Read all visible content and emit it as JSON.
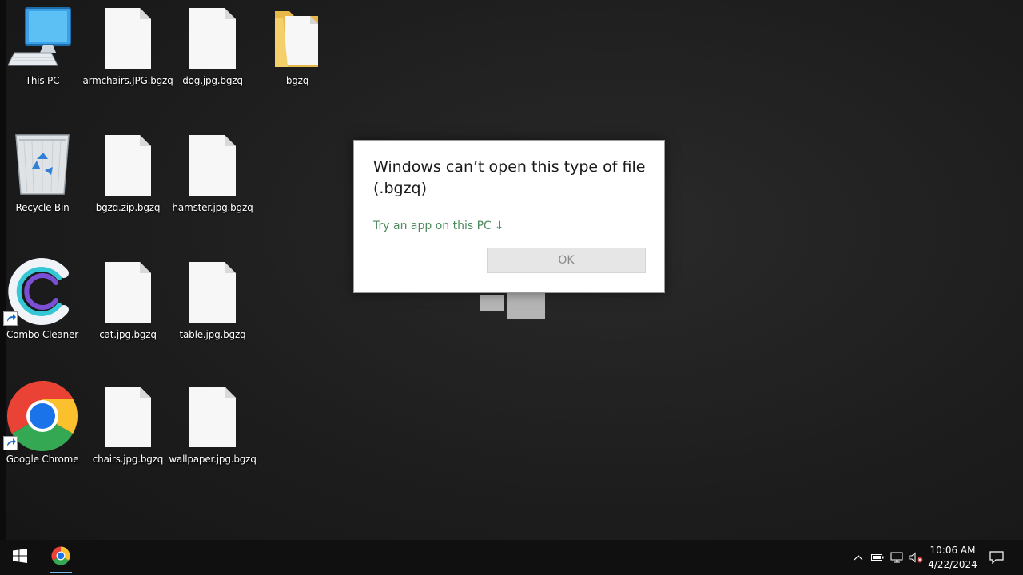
{
  "desktop": {
    "icons": [
      {
        "label": "This PC",
        "kind": "this-pc"
      },
      {
        "label": "armchairs.JPG.bgzq",
        "kind": "file"
      },
      {
        "label": "dog.jpg.bgzq",
        "kind": "file"
      },
      {
        "label": "bgzq",
        "kind": "folder"
      },
      {
        "label": "Recycle Bin",
        "kind": "recycle-bin"
      },
      {
        "label": "bgzq.zip.bgzq",
        "kind": "file"
      },
      {
        "label": "hamster.jpg.bgzq",
        "kind": "file"
      },
      {
        "label": "Combo Cleaner",
        "kind": "combo-cleaner-shortcut"
      },
      {
        "label": "cat.jpg.bgzq",
        "kind": "file"
      },
      {
        "label": "table.jpg.bgzq",
        "kind": "file"
      },
      {
        "label": "Google Chrome",
        "kind": "chrome-shortcut"
      },
      {
        "label": "chairs.jpg.bgzq",
        "kind": "file"
      },
      {
        "label": "wallpaper.jpg.bgzq",
        "kind": "file"
      }
    ]
  },
  "dialog": {
    "title": "Windows can’t open this type of file (.bgzq)",
    "link": "Try an app on this PC",
    "link_icon": "arrow-down-icon",
    "ok_label": "OK"
  },
  "taskbar": {
    "start_icon": "windows-logo-icon",
    "pinned": [
      "chrome-icon"
    ],
    "tray_icons": [
      "chevron-up-icon",
      "battery-icon",
      "network-icon",
      "volume-muted-icon"
    ],
    "time": "10:06 AM",
    "date": "4/22/2024",
    "notification_icon": "action-center-icon"
  },
  "colors": {
    "desktop_bg": "#1d1d1d",
    "taskbar_bg": "#101010",
    "dialog_link": "#4c8a5e"
  }
}
